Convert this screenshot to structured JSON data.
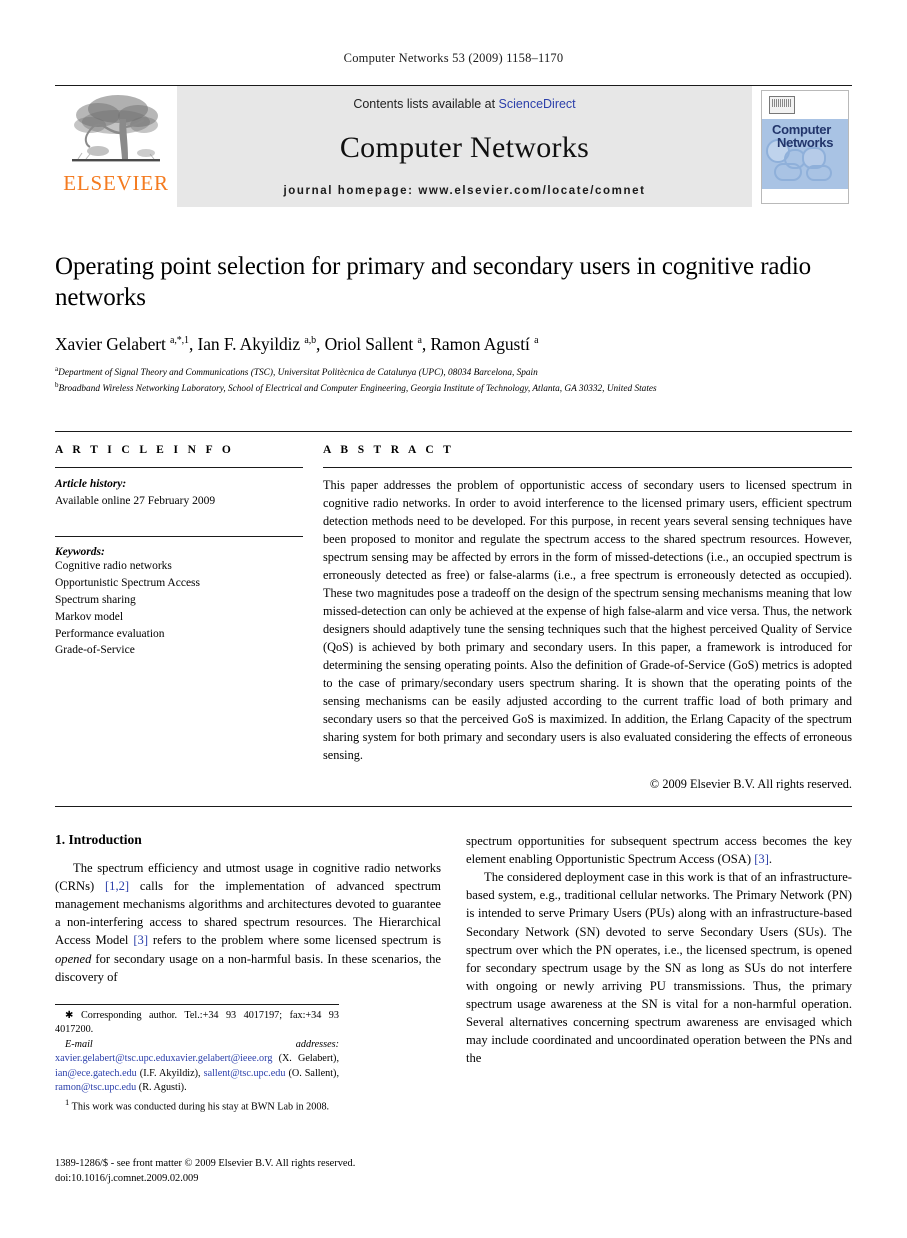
{
  "running_head": "Computer Networks 53 (2009) 1158–1170",
  "masthead": {
    "contents_prefix": "Contents lists available at ",
    "sciencedirect": "ScienceDirect",
    "journal_name": "Computer Networks",
    "homepage": "journal homepage: www.elsevier.com/locate/comnet",
    "publisher_wordmark": "ELSEVIER",
    "cover_title_line1": "Computer",
    "cover_title_line2": "Networks",
    "accent_orange": "#F47B20",
    "link_blue": "#2b3faa",
    "band_gray": "#e7e7e7",
    "cover_blue": "#a9c3e4"
  },
  "article": {
    "title": "Operating point selection for primary and secondary users in cognitive radio networks",
    "authors_html": "Xavier Gelabert <sup>a,*,1</sup>, Ian F. Akyildiz <sup>a,b</sup>, Oriol Sallent <sup>a</sup>, Ramon Agustí <sup>a</sup>",
    "affiliations": [
      "Department of Signal Theory and Communications (TSC), Universitat Politècnica de Catalunya (UPC), 08034 Barcelona, Spain",
      "Broadband Wireless Networking Laboratory, School of Electrical and Computer Engineering, Georgia Institute of Technology, Atlanta, GA 30332, United States"
    ],
    "affiliation_marks": [
      "a",
      "b"
    ]
  },
  "article_info": {
    "heading": "A R T I C L E    I N F O",
    "history_label": "Article history:",
    "history_value": "Available online 27 February 2009",
    "keywords_label": "Keywords:",
    "keywords": [
      "Cognitive radio networks",
      "Opportunistic Spectrum Access",
      "Spectrum sharing",
      "Markov model",
      "Performance evaluation",
      "Grade-of-Service"
    ]
  },
  "abstract": {
    "heading": "A B S T R A C T",
    "text": "This paper addresses the problem of opportunistic access of secondary users to licensed spectrum in cognitive radio networks. In order to avoid interference to the licensed primary users, efficient spectrum detection methods need to be developed. For this purpose, in recent years several sensing techniques have been proposed to monitor and regulate the spectrum access to the shared spectrum resources. However, spectrum sensing may be affected by errors in the form of missed-detections (i.e., an occupied spectrum is erroneously detected as free) or false-alarms (i.e., a free spectrum is erroneously detected as occupied). These two magnitudes pose a tradeoff on the design of the spectrum sensing mechanisms meaning that low missed-detection can only be achieved at the expense of high false-alarm and vice versa. Thus, the network designers should adaptively tune the sensing techniques such that the highest perceived Quality of Service (QoS) is achieved by both primary and secondary users. In this paper, a framework is introduced for determining the sensing operating points. Also the definition of Grade-of-Service (GoS) metrics is adopted to the case of primary/secondary users spectrum sharing. It is shown that the operating points of the sensing mechanisms can be easily adjusted according to the current traffic load of both primary and secondary users so that the perceived GoS is maximized. In addition, the Erlang Capacity of the spectrum sharing system for both primary and secondary users is also evaluated considering the effects of erroneous sensing.",
    "copyright": "© 2009 Elsevier B.V. All rights reserved."
  },
  "body": {
    "section_heading": "1. Introduction",
    "left_paragraph_parts": {
      "p1_a": "The spectrum efficiency and utmost usage in cognitive radio networks (CRNs) ",
      "p1_cite1": "[1,2]",
      "p1_b": " calls for the implementation of advanced spectrum management mechanisms algorithms and architectures devoted to guarantee a non-interfering access to shared spectrum resources. The Hierarchical Access Model ",
      "p1_cite2": "[3]",
      "p1_c": " refers to the problem where some licensed spectrum is ",
      "p1_italic": "opened",
      "p1_d": " for secondary usage on a non-harmful basis. In these scenarios, the discovery of"
    },
    "right_paragraph_parts": {
      "p1_cont_a": "spectrum opportunities for subsequent spectrum access becomes the key element enabling Opportunistic Spectrum Access (OSA) ",
      "p1_cont_cite": "[3]",
      "p1_cont_b": ".",
      "p2": "The considered deployment case in this work is that of an infrastructure-based system, e.g., traditional cellular networks. The Primary Network (PN) is intended to serve Primary Users (PUs) along with an infrastructure-based Secondary Network (SN) devoted to serve Secondary Users (SUs). The spectrum over which the PN operates, i.e., the licensed spectrum, is opened for secondary spectrum usage by the SN as long as SUs do not interfere with ongoing or newly arriving PU transmissions. Thus, the primary spectrum usage awareness at the SN is vital for a non-harmful operation. Several alternatives concerning spectrum awareness are envisaged which may include coordinated and uncoordinated operation between the PNs and the"
    }
  },
  "footnotes": {
    "corresponding": "Corresponding author. Tel.:+34 93 4017197; fax:+34 93 4017200.",
    "email_label": "E-mail addresses:",
    "emails": [
      {
        "address": "xavier.gelabert@tsc.upc.edu",
        "owner": ""
      },
      {
        "address": "xavier.gelabert@ieee.org",
        "owner": " (X. Gelabert), "
      },
      {
        "address": "ian@ece.gatech.edu",
        "owner": " (I.F. Akyildiz), "
      },
      {
        "address": "sallent@tsc.upc.edu",
        "owner": " (O. Sallent), "
      },
      {
        "address": "ramon@tsc.upc.edu",
        "owner": " (R. Agusti)."
      }
    ],
    "note1_marker": "1",
    "note1": "This work was conducted during his stay at BWN Lab in 2008."
  },
  "page_footer": {
    "line1": "1389-1286/$ - see front matter © 2009 Elsevier B.V. All rights reserved.",
    "line2": "doi:10.1016/j.comnet.2009.02.009"
  }
}
